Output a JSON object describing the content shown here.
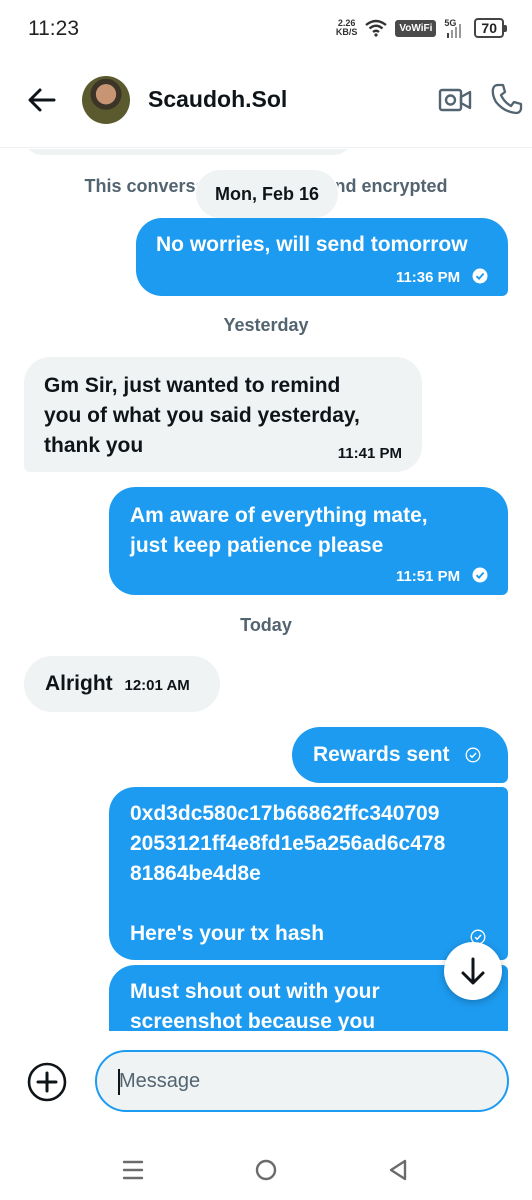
{
  "status_bar": {
    "time": "11:23",
    "net_speed_value": "2.26",
    "net_speed_unit": "KB/S",
    "vowifi": "VoWiFi",
    "network": "5G",
    "battery": "70"
  },
  "header": {
    "contact_name": "Scaudoh.Sol",
    "icons": [
      "back-arrow-icon",
      "video-camera-icon",
      "phone-icon"
    ]
  },
  "conversation": {
    "encryption_notice": "This conversation is end-to-end encrypted",
    "floating_date": "Mon, Feb 16",
    "messages": [
      {
        "direction": "out",
        "text": "No worries, will send tomorrow",
        "time": "11:36 PM",
        "read": true
      },
      {
        "day": "Yesterday"
      },
      {
        "direction": "in",
        "lines": [
          "Gm Sir, just wanted to remind",
          "you of what you said yesterday,",
          "thank you"
        ],
        "time": "11:41 PM"
      },
      {
        "direction": "out",
        "lines": [
          "Am aware of everything mate,",
          "just keep patience please"
        ],
        "time": "11:51 PM",
        "read": true
      },
      {
        "day": "Today"
      },
      {
        "direction": "in",
        "text": "Alright",
        "time": "12:01 AM"
      },
      {
        "direction": "out",
        "text": "Rewards sent",
        "read": false
      },
      {
        "direction": "out",
        "lines": [
          "0xd3dc580c17b66862ffc340709",
          "2053121ff4e8fd1e5a256ad6c478",
          "81864be4d8e"
        ],
        "caption": "Here's your tx hash",
        "read": false
      },
      {
        "direction": "out",
        "lines": [
          "Must shout out with your",
          "screenshot because you"
        ]
      }
    ]
  },
  "composer": {
    "placeholder": "Message"
  },
  "colors": {
    "accent": "#1d9bf0",
    "incoming_bubble": "#eff3f4",
    "muted_text": "#536471"
  }
}
